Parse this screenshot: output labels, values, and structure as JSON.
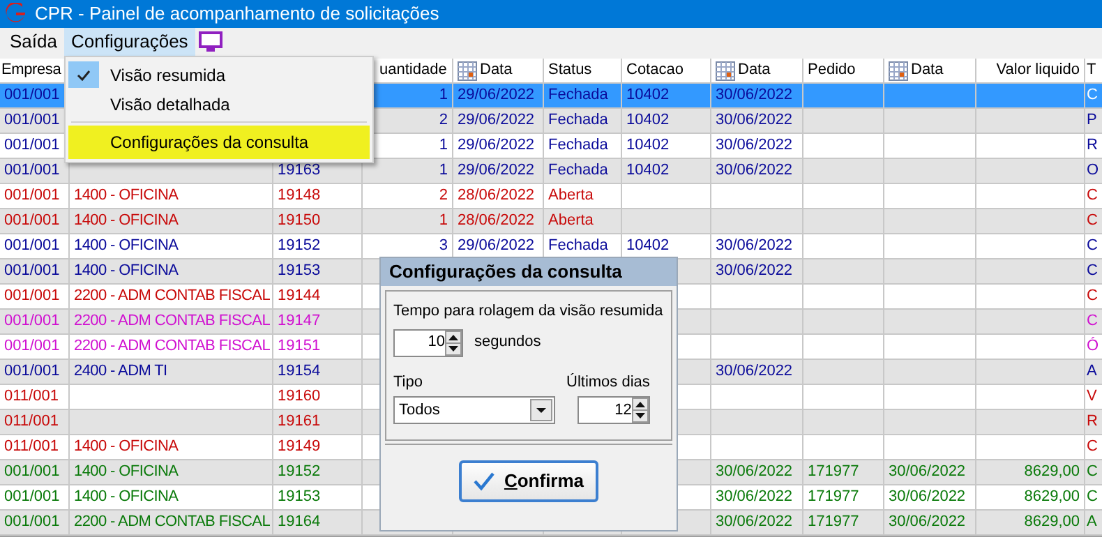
{
  "window": {
    "title": "CPR - Painel de acompanhamento de solicitações"
  },
  "menubar": [
    {
      "label": "Saída",
      "selected": false
    },
    {
      "label": "Configurações",
      "selected": true
    }
  ],
  "menu": [
    {
      "label": "Visão resumida",
      "checked": true,
      "selected": false
    },
    {
      "label": "Visão detalhada",
      "checked": false,
      "selected": false
    },
    {
      "label": "Configurações da consulta",
      "checked": false,
      "selected": true
    }
  ],
  "table": {
    "columns": [
      {
        "label": "Empresa",
        "kind": "text"
      },
      {
        "kind": "text"
      },
      {
        "kind": "text"
      },
      {
        "label": "uantidade",
        "kind": "number"
      },
      {
        "label": "Data",
        "kind": "date"
      },
      {
        "label": "Status",
        "kind": "text"
      },
      {
        "label": "Cotacao",
        "kind": "text"
      },
      {
        "label": "Data",
        "kind": "date"
      },
      {
        "label": "Pedido",
        "kind": "text"
      },
      {
        "label": "Data",
        "kind": "date"
      },
      {
        "label": "Valor liquido",
        "kind": "number"
      },
      {
        "label": "T",
        "kind": "text"
      }
    ],
    "rows": [
      {
        "color": "#0a0a9a",
        "selected": true,
        "cells": [
          "001/001",
          null,
          null,
          "1",
          "29/06/2022",
          "Fechada",
          "10402",
          "30/06/2022",
          null,
          null,
          null,
          "C"
        ]
      },
      {
        "color": "#0a0a9a",
        "selected": false,
        "cells": [
          "001/001",
          null,
          null,
          "2",
          "29/06/2022",
          "Fechada",
          "10402",
          "30/06/2022",
          null,
          null,
          null,
          "P"
        ]
      },
      {
        "color": "#0a0a9a",
        "selected": false,
        "cells": [
          "001/001",
          null,
          null,
          "1",
          "29/06/2022",
          "Fechada",
          "10402",
          "30/06/2022",
          null,
          null,
          null,
          "R"
        ]
      },
      {
        "color": "#0a0a9a",
        "selected": false,
        "cells": [
          "001/001",
          null,
          "19163",
          "1",
          "29/06/2022",
          "Fechada",
          "10402",
          "30/06/2022",
          null,
          null,
          null,
          "O"
        ]
      },
      {
        "color": "#c80a0a",
        "selected": false,
        "cells": [
          "001/001",
          "1400 - OFICINA",
          "19148",
          "2",
          "28/06/2022",
          "Aberta",
          null,
          null,
          null,
          null,
          null,
          "C"
        ]
      },
      {
        "color": "#c80a0a",
        "selected": false,
        "cells": [
          "001/001",
          "1400 - OFICINA",
          "19150",
          "1",
          "28/06/2022",
          "Aberta",
          null,
          null,
          null,
          null,
          null,
          "C"
        ]
      },
      {
        "color": "#0a0a9a",
        "selected": false,
        "cells": [
          "001/001",
          "1400 - OFICINA",
          "19152",
          "3",
          "29/06/2022",
          "Fechada",
          "10402",
          "30/06/2022",
          null,
          null,
          null,
          "C"
        ]
      },
      {
        "color": "#0a0a9a",
        "selected": false,
        "cells": [
          "001/001",
          "1400 - OFICINA",
          "19153",
          null,
          null,
          null,
          null,
          "30/06/2022",
          null,
          null,
          null,
          "C"
        ]
      },
      {
        "color": "#c80a0a",
        "selected": false,
        "cells": [
          "001/001",
          "2200 - ADM CONTAB FISCAL",
          "19144",
          null,
          null,
          null,
          null,
          null,
          null,
          null,
          null,
          "C"
        ]
      },
      {
        "color": "#d010d0",
        "selected": false,
        "cells": [
          "001/001",
          "2200 - ADM CONTAB FISCAL",
          "19147",
          null,
          null,
          null,
          null,
          null,
          null,
          null,
          null,
          "C"
        ]
      },
      {
        "color": "#d010d0",
        "selected": false,
        "cells": [
          "001/001",
          "2200 - ADM CONTAB FISCAL",
          "19151",
          null,
          null,
          null,
          null,
          null,
          null,
          null,
          null,
          "Ó"
        ]
      },
      {
        "color": "#0a0a9a",
        "selected": false,
        "cells": [
          "001/001",
          "2400 - ADM TI",
          "19154",
          null,
          null,
          null,
          null,
          "30/06/2022",
          null,
          null,
          null,
          "A"
        ]
      },
      {
        "color": "#c80a0a",
        "selected": false,
        "cells": [
          "011/001",
          null,
          "19160",
          null,
          null,
          null,
          null,
          null,
          null,
          null,
          null,
          "V"
        ]
      },
      {
        "color": "#c80a0a",
        "selected": false,
        "cells": [
          "011/001",
          null,
          "19161",
          null,
          null,
          null,
          null,
          null,
          null,
          null,
          null,
          "R"
        ]
      },
      {
        "color": "#c80a0a",
        "selected": false,
        "cells": [
          "011/001",
          "1400 - OFICINA",
          "19149",
          null,
          null,
          null,
          null,
          null,
          null,
          null,
          null,
          "C"
        ]
      },
      {
        "color": "#0a7a0a",
        "selected": false,
        "cells": [
          "001/001",
          "1400 - OFICINA",
          "19152",
          null,
          null,
          null,
          null,
          "30/06/2022",
          "171977",
          "30/06/2022",
          "8629,00",
          "C"
        ]
      },
      {
        "color": "#0a7a0a",
        "selected": false,
        "cells": [
          "001/001",
          "1400 - OFICINA",
          "19153",
          null,
          null,
          null,
          null,
          "30/06/2022",
          "171977",
          "30/06/2022",
          "8629,00",
          "C"
        ]
      },
      {
        "color": "#0a7a0a",
        "selected": false,
        "cells": [
          "001/001",
          "2200 - ADM CONTAB FISCAL",
          "19164",
          null,
          null,
          null,
          null,
          "30/06/2022",
          "171977",
          "30/06/2022",
          "8629,00",
          "A"
        ]
      }
    ]
  },
  "dialog": {
    "title": "Configurações da consulta",
    "interval_label": "Tempo para rolagem da visão resumida",
    "interval_value": "10",
    "interval_unit": "segundos",
    "type_label": "Tipo",
    "type_value": "Todos",
    "days_label": "Últimos dias",
    "days_value": "12",
    "confirm": {
      "label": "Confirma"
    }
  }
}
